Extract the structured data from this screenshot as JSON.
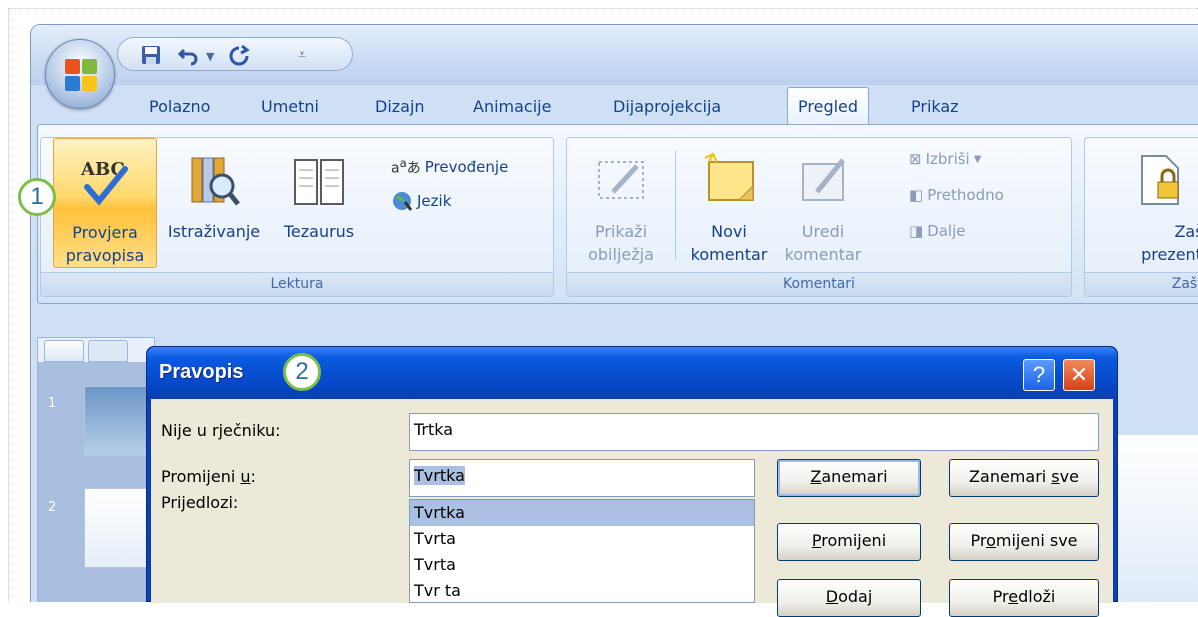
{
  "qat": {
    "save_icon": "save-icon",
    "undo_icon": "undo-icon",
    "redo_icon": "redo-icon",
    "customize_icon": "customize-qat-icon"
  },
  "tabs": [
    "Polazno",
    "Umetni",
    "Dizajn",
    "Animacije",
    "Dijaprojekcija",
    "Pregled",
    "Prikaz"
  ],
  "active_tab": "Pregled",
  "ribbon": {
    "lektura": {
      "label": "Lektura",
      "spell_check_line1": "Provjera",
      "spell_check_line2": "pravopisa",
      "research": "Istraživanje",
      "thesaurus": "Tezaurus",
      "translate": "Prevođenje",
      "language": "Jezik"
    },
    "komentari": {
      "label": "Komentari",
      "show_markup_line1": "Prikaži",
      "show_markup_line2": "obilježja",
      "new_comment_line1": "Novi",
      "new_comment_line2": "komentar",
      "edit_comment_line1": "Uredi",
      "edit_comment_line2": "komentar",
      "delete": "Izbriši",
      "previous": "Prethodno",
      "next": "Dalje"
    },
    "zastiti": {
      "label": "Zaštiti",
      "protect_line1": "Zaštiti",
      "protect_line2": "prezentaci"
    }
  },
  "callouts": {
    "one": "1",
    "two": "2"
  },
  "thumbnails": {
    "slide1_num": "1",
    "slide2_num": "2"
  },
  "dialog": {
    "title": "Pravopis",
    "help": "?",
    "close": "✕",
    "not_in_dictionary_label": "Nije u rječniku:",
    "not_in_dictionary_value": "Trtka",
    "change_to_label_pre": "Promijeni ",
    "change_to_label_u": "u",
    "change_to_label_post": ":",
    "change_to_value": "Tvrtka",
    "suggestions_label": "Prijedlozi:",
    "suggestions": [
      "Tvrtka",
      "Tvrta",
      "Tvrta",
      "Tvr ta"
    ],
    "buttons": {
      "ignore_pre": "",
      "ignore_u": "Z",
      "ignore_post": "anemari",
      "ignore_all_pre": "Zanemari ",
      "ignore_all_u": "s",
      "ignore_all_post": "ve",
      "change_pre": "",
      "change_u": "P",
      "change_post": "romijeni",
      "change_all_pre": "Pr",
      "change_all_u": "o",
      "change_all_post": "mijeni sve",
      "add_pre": "",
      "add_u": "D",
      "add_post": "odaj",
      "suggest_pre": "Pr",
      "suggest_u": "e",
      "suggest_post": "dloži"
    }
  }
}
